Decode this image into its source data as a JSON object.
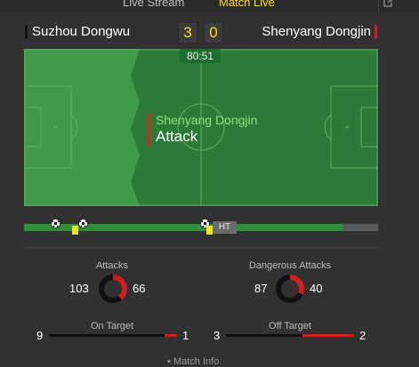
{
  "tabs": [
    {
      "label": "Live Stream"
    },
    {
      "label": "Match Live"
    }
  ],
  "popout_icon": "popout-icon",
  "match": {
    "home_team": "Suzhou Dongwu",
    "away_team": "Shenyang Dongjin",
    "home_score": "3",
    "away_score": "0",
    "clock": "80:51",
    "home_color": "#111111",
    "away_color": "#d31c1c"
  },
  "event": {
    "team": "Shenyang Dongjin",
    "action": "Attack"
  },
  "timeline": {
    "progress_fraction": 0.9,
    "ht_label": "HT",
    "goals_minutes": [
      8,
      15,
      46
    ],
    "yellow_card_minutes": [
      13,
      47
    ]
  },
  "stats": {
    "attacks": {
      "label": "Attacks",
      "home": "103",
      "away": "66"
    },
    "dangerous_attacks": {
      "label": "Dangerous Attacks",
      "home": "87",
      "away": "40"
    },
    "on_target": {
      "label": "On Target",
      "home": "9",
      "away": "1"
    },
    "off_target": {
      "label": "Off Target",
      "home": "3",
      "away": "2"
    }
  },
  "footer": {
    "label": "Match Info"
  }
}
